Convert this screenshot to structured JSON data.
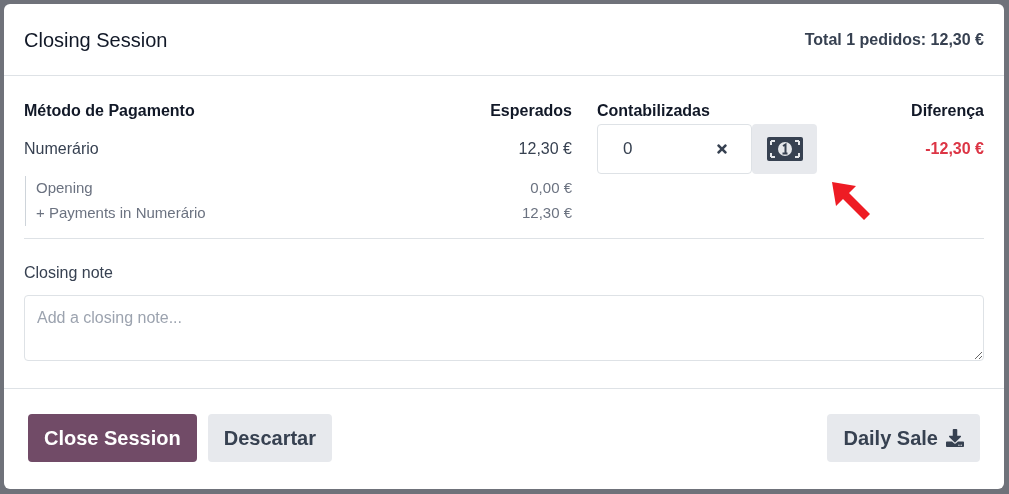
{
  "title": "Closing Session",
  "total": "Total 1 pedidos: 12,30 €",
  "columns": [
    "Método de Pagamento",
    "Esperados",
    "Contabilizadas",
    "Diferença"
  ],
  "payment_methods": [
    {
      "name": "Numerário",
      "expected": "12,30 €",
      "counted": "0",
      "difference": "-12,30 €",
      "negative": true,
      "details": [
        {
          "label": "Opening",
          "amount": "0,00 €"
        },
        {
          "label": "+ Payments in Numerário",
          "amount": "12,30 €"
        }
      ]
    }
  ],
  "closing_note": {
    "label": "Closing note",
    "placeholder": "Add a closing note..."
  },
  "buttons": [
    {
      "label": "Close Session",
      "kind": "primary"
    },
    {
      "label": "Descartar",
      "kind": "secondary"
    },
    {
      "label": "Daily Sale",
      "kind": "download"
    }
  ]
}
